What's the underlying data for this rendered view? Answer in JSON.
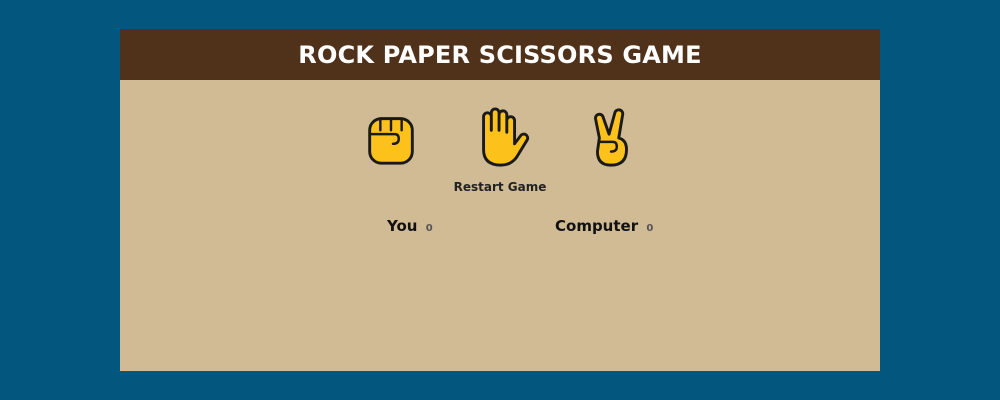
{
  "title": "ROCK PAPER SCISSORS GAME",
  "choices": [
    {
      "name": "rock",
      "icon": "raised-fist-icon"
    },
    {
      "name": "paper",
      "icon": "raised-hand-icon"
    },
    {
      "name": "scissors",
      "icon": "victory-hand-icon"
    }
  ],
  "restart_label": "Restart Game",
  "scores": {
    "you_label": "You",
    "you_value": "0",
    "computer_label": "Computer",
    "computer_value": "0"
  },
  "colors": {
    "background": "#03577e",
    "panel": "#d1bb94",
    "header": "#50321b",
    "emoji_yellow": "#fcc21b"
  }
}
